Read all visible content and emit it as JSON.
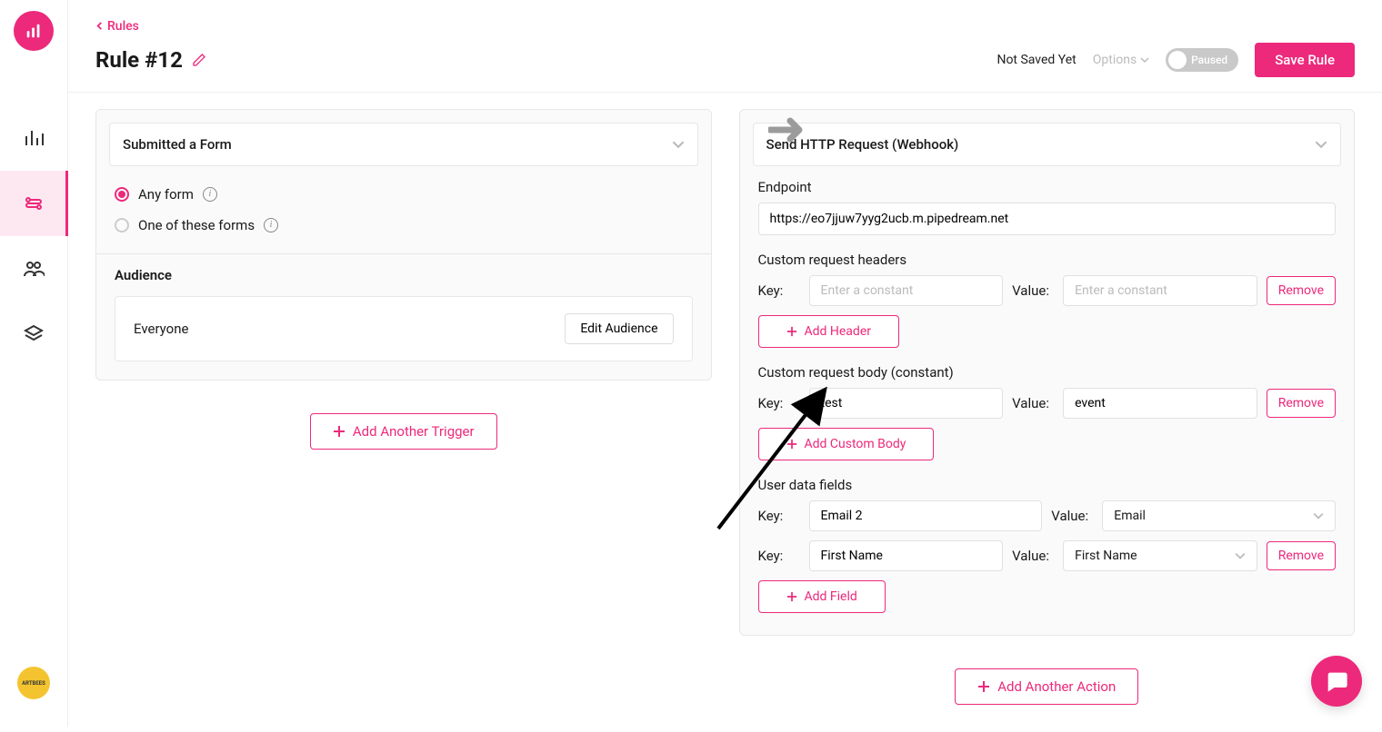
{
  "breadcrumb": {
    "label": "Rules"
  },
  "page": {
    "title": "Rule #12"
  },
  "header": {
    "status": "Not Saved Yet",
    "options": "Options",
    "toggle_label": "Paused",
    "save": "Save Rule"
  },
  "trigger": {
    "select_label": "Submitted a Form",
    "radio_any": "Any form",
    "radio_one": "One of these forms",
    "audience_title": "Audience",
    "audience_value": "Everyone",
    "edit_audience": "Edit Audience",
    "add_trigger": "Add Another Trigger"
  },
  "action": {
    "select_label": "Send HTTP Request (Webhook)",
    "endpoint_label": "Endpoint",
    "endpoint_value": "https://eo7jjuw7yyg2ucb.m.pipedream.net",
    "headers_title": "Custom request headers",
    "key_label": "Key:",
    "value_label": "Value:",
    "placeholder_constant": "Enter a constant",
    "remove": "Remove",
    "add_header": "Add Header",
    "body_title": "Custom request body (constant)",
    "body_key": "test",
    "body_value": "event",
    "add_body": "Add Custom Body",
    "fields_title": "User data fields",
    "field1_key": "Email 2",
    "field1_value": "Email",
    "field2_key": "First Name",
    "field2_value": "First Name",
    "add_field": "Add Field",
    "add_action": "Add Another Action"
  },
  "badge": {
    "text": "ARTBEES"
  }
}
